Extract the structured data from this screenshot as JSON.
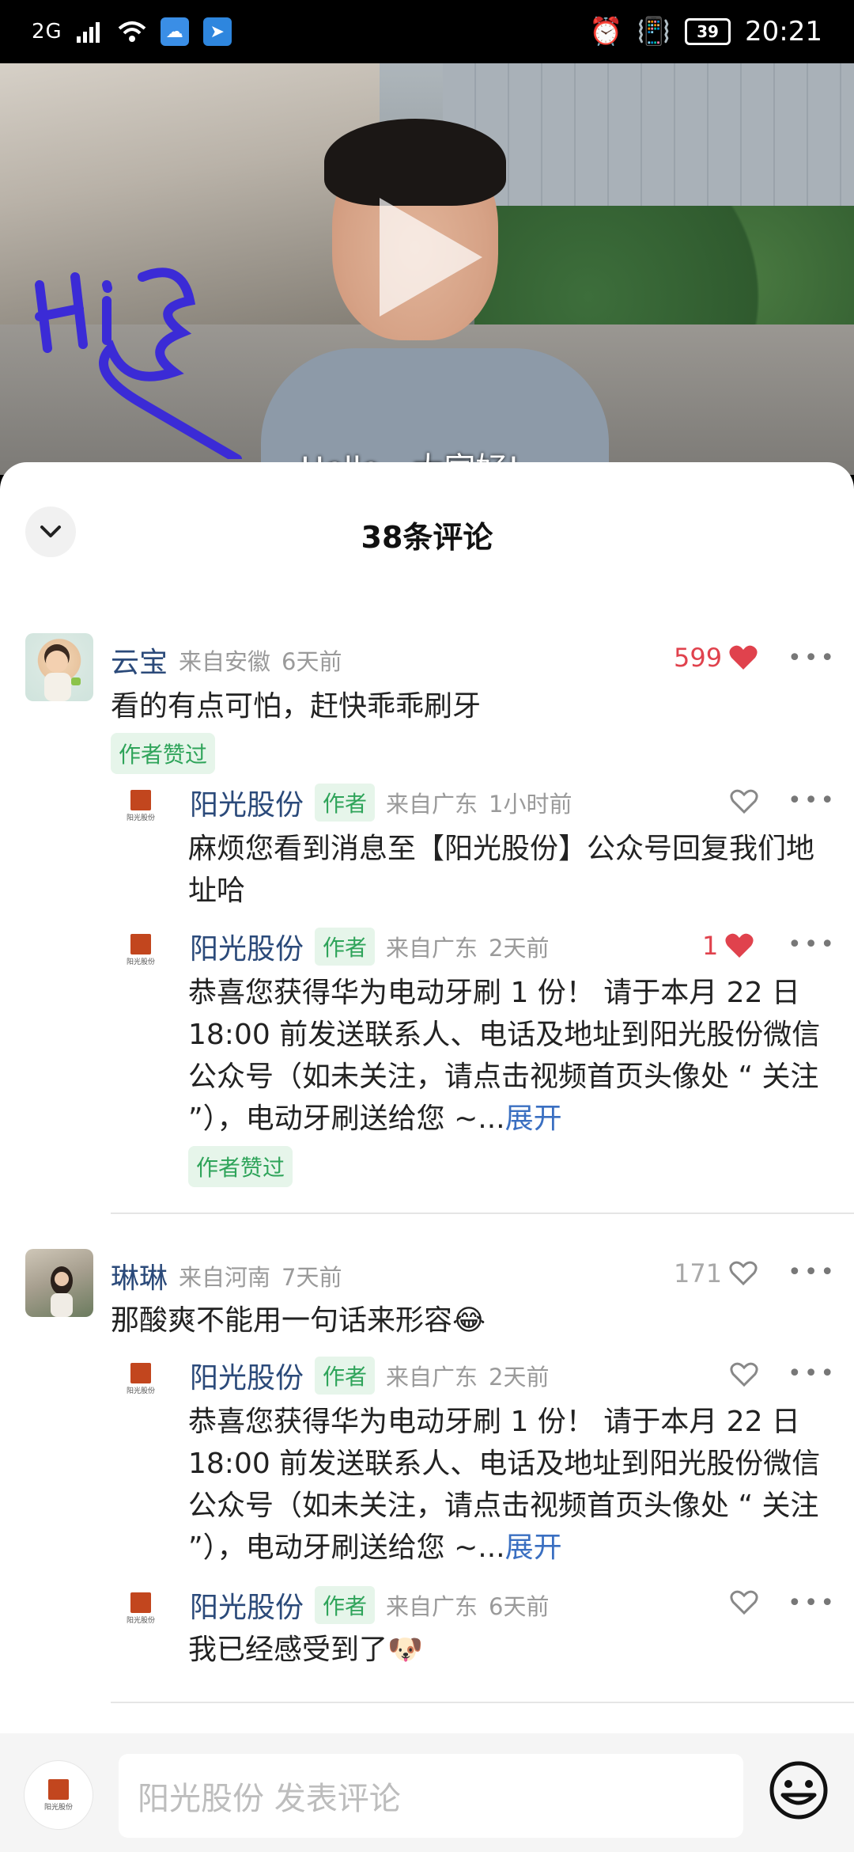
{
  "status_bar": {
    "signal": "2G",
    "time": "20:21",
    "battery": "39"
  },
  "video": {
    "caption": "Hello，大家好!"
  },
  "sheet": {
    "title": "38条评论"
  },
  "comments": [
    {
      "author": "云宝",
      "location": "来自安徽",
      "time": "6天前",
      "likes": "599",
      "text": "看的有点可怕，赶快乖乖刷牙",
      "liked_by_author": "作者赞过",
      "replies": [
        {
          "author": "阳光股份",
          "tag": "作者",
          "location": "来自广东",
          "time": "1小时前",
          "likes": "",
          "text": "麻烦您看到消息至【阳光股份】公众号回复我们地址哈"
        },
        {
          "author": "阳光股份",
          "tag": "作者",
          "location": "来自广东",
          "time": "2天前",
          "likes": "1",
          "text": "恭喜您获得华为电动牙刷 1 份！ 请于本月 22 日 18:00 前发送联系人、电话及地址到阳光股份微信公众号（如未关注，请点击视频首页头像处 “ 关注 ”），电动牙刷送给您 ~...",
          "expand": "展开",
          "liked_by_author": "作者赞过"
        }
      ]
    },
    {
      "author": "琳琳",
      "location": "来自河南",
      "time": "7天前",
      "likes": "171",
      "text": "那酸爽不能用一句话来形容",
      "replies": [
        {
          "author": "阳光股份",
          "tag": "作者",
          "location": "来自广东",
          "time": "2天前",
          "likes": "",
          "text": "恭喜您获得华为电动牙刷 1 份！ 请于本月 22 日 18:00 前发送联系人、电话及地址到阳光股份微信公众号（如未关注，请点击视频首页头像处 “ 关注 ”），电动牙刷送给您 ~...",
          "expand": "展开"
        },
        {
          "author": "阳光股份",
          "tag": "作者",
          "location": "来自广东",
          "time": "6天前",
          "likes": "",
          "text": "我已经感受到了"
        }
      ]
    }
  ],
  "bottom_bar": {
    "placeholder": "阳光股份 发表评论"
  },
  "logo": {
    "caption": "阳光股份"
  },
  "colors": {
    "accent_red": "#e0424d",
    "author_green": "#2fa45a",
    "name_blue": "#2b4a7a",
    "link_blue": "#3a6fc1"
  }
}
